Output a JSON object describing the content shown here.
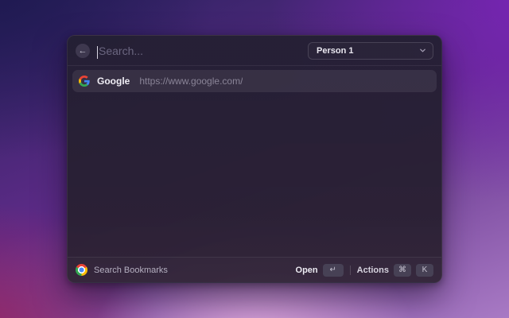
{
  "window": {
    "header": {
      "back_icon": "←",
      "search_placeholder": "Search...",
      "dropdown": {
        "value": "Person 1"
      }
    },
    "list": {
      "items": [
        {
          "icon": "google-favicon",
          "title": "Google",
          "subtitle": "https://www.google.com/"
        }
      ]
    },
    "footer": {
      "app_icon": "chrome-logo",
      "app_label": "Search Bookmarks",
      "open_label": "Open",
      "open_key": "↵",
      "actions_label": "Actions",
      "actions_keys": [
        "⌘",
        "K"
      ]
    }
  },
  "colors": {
    "window_bg": "#27213a",
    "selected_row_bg": "#3b3449",
    "title_text": "#f0eef5",
    "subtitle_text": "#8a8497",
    "placeholder_text": "#6b6680",
    "badge_bg": "#474155",
    "desktop_top_left": "#1e1950",
    "desktop_top_right": "#7a24b8",
    "desktop_bottom_left": "#96235f",
    "desktop_bottom_center": "#e7b2e2"
  }
}
